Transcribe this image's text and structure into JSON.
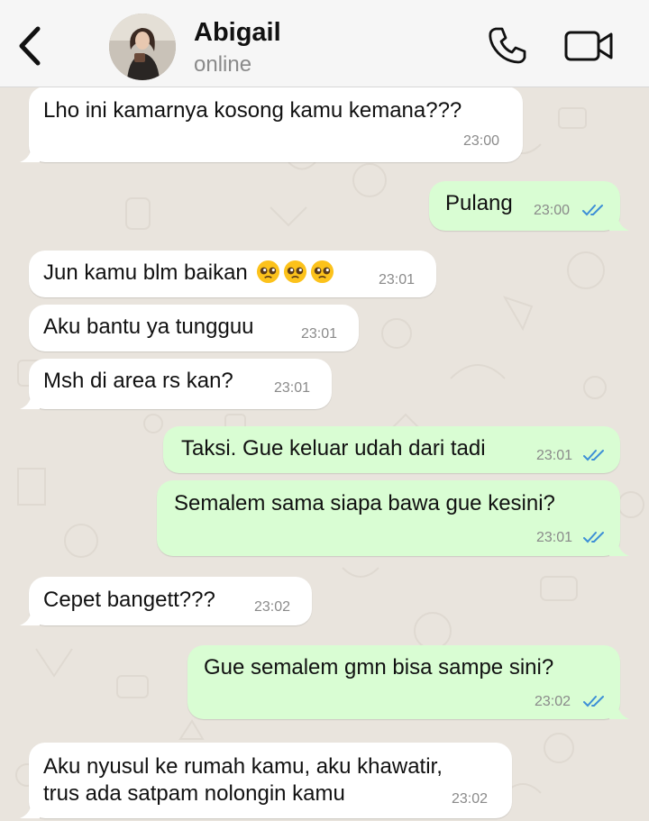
{
  "header": {
    "contact_name": "Abigail",
    "status": "online"
  },
  "colors": {
    "background": "#e9e4dd",
    "incoming_bubble": "#ffffff",
    "outgoing_bubble": "#d9fdd3",
    "read_ticks": "#3d8fd6"
  },
  "icons": {
    "back": "chevron-left-icon",
    "call": "phone-icon",
    "video": "video-camera-icon",
    "read": "double-check-icon",
    "emoji": "pleading-face-emoji"
  },
  "messages": [
    {
      "direction": "in",
      "text": "Lho ini kamarnya kosong kamu kemana???",
      "time": "23:00"
    },
    {
      "direction": "out",
      "text": "Pulang",
      "time": "23:00",
      "read": true
    },
    {
      "direction": "in",
      "text": "Jun kamu blm baikan",
      "emoji_count": 3,
      "time": "23:01"
    },
    {
      "direction": "in",
      "text": "Aku bantu ya tungguu",
      "time": "23:01"
    },
    {
      "direction": "in",
      "text": "Msh di area rs kan?",
      "time": "23:01"
    },
    {
      "direction": "out",
      "text": "Taksi. Gue keluar udah dari tadi",
      "time": "23:01",
      "read": true
    },
    {
      "direction": "out",
      "text": "Semalem sama siapa bawa gue kesini?",
      "time": "23:01",
      "read": true
    },
    {
      "direction": "in",
      "text": "Cepet bangett???",
      "time": "23:02"
    },
    {
      "direction": "out",
      "text": "Gue semalem gmn bisa sampe sini?",
      "time": "23:02",
      "read": true
    },
    {
      "direction": "in",
      "text_line1": "Aku nyusul ke rumah kamu, aku khawatir,",
      "text_line2": "trus ada satpam nolongin kamu",
      "time": "23:02"
    }
  ]
}
